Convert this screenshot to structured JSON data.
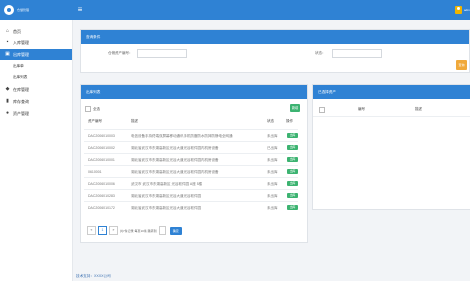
{
  "app": {
    "logo_text": "仓储管理",
    "user_name": "admin"
  },
  "sidebar": {
    "items": [
      {
        "label": "首页",
        "icon": "home-icon"
      },
      {
        "label": "入库管理",
        "icon": "box-icon"
      },
      {
        "label": "出库管理",
        "icon": "truck-icon"
      },
      {
        "label": "出库单",
        "sub": true
      },
      {
        "label": "出库列表",
        "sub": true
      },
      {
        "label": "在库管理",
        "icon": "shelf-icon"
      },
      {
        "label": "库存查询",
        "icon": "chart-icon"
      },
      {
        "label": "资产管理",
        "icon": "asset-icon"
      }
    ]
  },
  "search_panel": {
    "title": "查询条件",
    "field1_label": "仓储资产编号：",
    "field1_value": "",
    "field2_label": "状态：",
    "field2_value": "",
    "search_button": "查询"
  },
  "list_panel": {
    "title": "出库列表",
    "select_all_label": "全选",
    "add_button": "新增",
    "columns": [
      "资产编号",
      "描述",
      "状态",
      "操作"
    ],
    "rows": [
      {
        "code": "DAC2006010003",
        "desc": "电信设备手持终端双屏幕移动通讯手机防震防水防摔防静电全网通",
        "status": "未出库",
        "op": "出库"
      },
      {
        "code": "DAC2006010002",
        "desc": "湖北省武汉市东湖高新区光谷大道光谷软件园内机房设备",
        "status": "已出库",
        "op": "出库"
      },
      {
        "code": "DAC2006010001",
        "desc": "湖北省武汉市东湖高新区光谷大道光谷软件园内机房设备",
        "status": "未出库",
        "op": "出库"
      },
      {
        "code": "0610001",
        "desc": "湖北省武汉市东湖高新区光谷大道光谷软件园内机房设备",
        "status": "未出库",
        "op": "出库"
      },
      {
        "code": "DAC2006010006",
        "desc": "武汉市 武汉市东湖高新区 光谷软件园 A座 5楼",
        "status": "未出库",
        "op": "出库"
      },
      {
        "code": "DAC2006010283",
        "desc": "湖北省武汉市东湖高新区光谷大道光谷软件园",
        "status": "未出库",
        "op": "出库"
      },
      {
        "code": "DAC2006010172",
        "desc": "湖北省武汉市东湖高新区光谷大道光谷软件园",
        "status": "未出库",
        "op": "出库"
      }
    ],
    "pager": {
      "prev": "«",
      "page": "1",
      "next": "»",
      "info": "共7条记录 每页10条 跳转到",
      "go": "确定"
    }
  },
  "selected_panel": {
    "title": "已选择资产",
    "columns": [
      "编号",
      "描述"
    ]
  },
  "footer": {
    "text": "技术支持：XXXX公司"
  },
  "colors": {
    "primary": "#2f82d4",
    "success": "#3cb371",
    "warning": "#f0a93b"
  }
}
